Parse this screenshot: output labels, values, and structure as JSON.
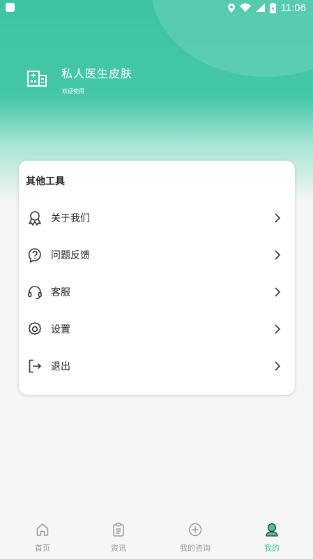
{
  "status_bar": {
    "time": "11:06"
  },
  "header": {
    "title": "私人医生皮肤",
    "subtitle": "欢迎使用"
  },
  "tools": {
    "title": "其他工具",
    "items": [
      {
        "label": "关于我们",
        "icon": "award-icon"
      },
      {
        "label": "问题反馈",
        "icon": "help-icon"
      },
      {
        "label": "客服",
        "icon": "headset-icon"
      },
      {
        "label": "设置",
        "icon": "gear-icon"
      },
      {
        "label": "退出",
        "icon": "logout-icon"
      }
    ]
  },
  "tabbar": {
    "items": [
      {
        "label": "首页",
        "icon": "home-icon",
        "active": false
      },
      {
        "label": "资讯",
        "icon": "clipboard-icon",
        "active": false
      },
      {
        "label": "我的咨询",
        "icon": "plus-circle-icon",
        "active": false
      },
      {
        "label": "我的",
        "icon": "user-icon",
        "active": true
      }
    ]
  },
  "colors": {
    "brand": "#3fc3a2",
    "text": "#222222",
    "inactive": "#9a9a9a"
  }
}
